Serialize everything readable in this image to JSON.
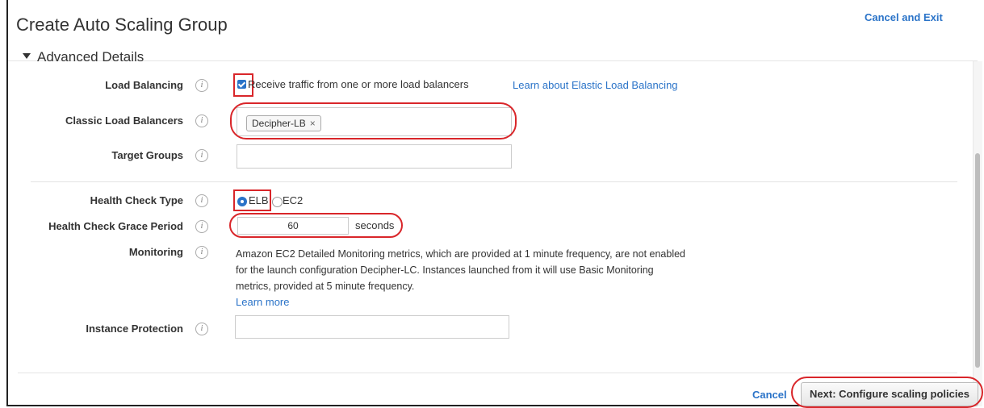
{
  "header": {
    "title": "Create Auto Scaling Group",
    "cancel_exit": "Cancel and Exit"
  },
  "section": {
    "title": "Advanced Details"
  },
  "info_glyph": "i",
  "fields": {
    "load_balancing": {
      "label": "Load Balancing",
      "checkbox_checked": true,
      "checkbox_text": "Receive traffic from one or more load balancers",
      "learn_link": "Learn about Elastic Load Balancing"
    },
    "classic_lb": {
      "label": "Classic Load Balancers",
      "tag": "Decipher-LB",
      "tag_remove": "×"
    },
    "target_groups": {
      "label": "Target Groups",
      "value": ""
    },
    "health_check_type": {
      "label": "Health Check Type",
      "options": [
        "ELB",
        "EC2"
      ],
      "selected": "ELB"
    },
    "grace_period": {
      "label": "Health Check Grace Period",
      "value": "60",
      "unit": "seconds"
    },
    "monitoring": {
      "label": "Monitoring",
      "text": "Amazon EC2 Detailed Monitoring metrics, which are provided at 1 minute frequency, are not enabled for the launch configuration Decipher-LC. Instances launched from it will use Basic Monitoring metrics, provided at 5 minute frequency.",
      "learn_more": "Learn more"
    },
    "instance_protection": {
      "label": "Instance Protection",
      "value": ""
    }
  },
  "footer": {
    "cancel": "Cancel",
    "next": "Next: Configure scaling policies"
  },
  "colors": {
    "link": "#2a73c8",
    "annotation": "#d9262a"
  },
  "icons": [
    "info-icon",
    "checkbox-checked-icon",
    "radio-selected-icon",
    "radio-unselected-icon",
    "remove-tag-icon",
    "collapse-arrow-icon"
  ]
}
